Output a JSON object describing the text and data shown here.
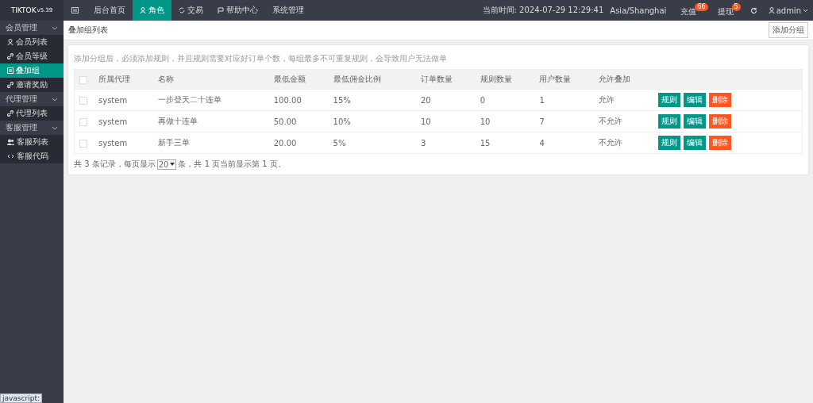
{
  "logo": {
    "name": "TIKTOK",
    "version": "v5.39"
  },
  "top_nav": [
    {
      "label": "后台首页",
      "selected": false
    },
    {
      "label": "角色",
      "selected": true
    },
    {
      "label": "交易",
      "selected": false
    },
    {
      "label": "帮助中心",
      "selected": false
    },
    {
      "label": "系统管理",
      "selected": false
    }
  ],
  "header_right": {
    "time_label": "当前时间: 2024-07-29 12:29:41",
    "timezone": "Asia/Shanghai",
    "links": [
      {
        "label": "充值",
        "badge": "66"
      },
      {
        "label": "提现",
        "badge": "5"
      }
    ],
    "user": "admin"
  },
  "sidebar": [
    {
      "label": "会员管理",
      "expanded": true,
      "children": [
        {
          "label": "会员列表",
          "selected": false
        },
        {
          "label": "会员等级",
          "selected": false
        },
        {
          "label": "叠加组",
          "selected": true
        },
        {
          "label": "邀请奖励",
          "selected": false
        }
      ]
    },
    {
      "label": "代理管理",
      "expanded": true,
      "children": [
        {
          "label": "代理列表",
          "selected": false
        }
      ]
    },
    {
      "label": "客服管理",
      "expanded": true,
      "children": [
        {
          "label": "客服列表",
          "selected": false
        },
        {
          "label": "客服代码",
          "selected": false
        }
      ]
    }
  ],
  "breadcrumb": "叠加组列表",
  "add_button": "添加分组",
  "notice": "添加分组后，必须添加规则，并且规则需要对应好订单个数，每组最多不可重复规则，会导致用户无法做单",
  "table": {
    "columns": [
      "所属代理",
      "名称",
      "最低金额",
      "最低佣金比例",
      "订单数量",
      "规则数量",
      "用户数量",
      "允许叠加"
    ],
    "header_checked": false,
    "rows": [
      {
        "checked": false,
        "cells": [
          "system",
          "一步登天二十连单",
          "100.00",
          "15%",
          "20",
          "0",
          "1",
          "允许"
        ],
        "actions": [
          "规则",
          "编辑",
          "删除"
        ]
      },
      {
        "checked": false,
        "cells": [
          "system",
          "再做十连单",
          "50.00",
          "10%",
          "10",
          "10",
          "7",
          "不允许"
        ],
        "actions": [
          "规则",
          "编辑",
          "删除"
        ]
      },
      {
        "checked": false,
        "cells": [
          "system",
          "新手三单",
          "20.00",
          "5%",
          "3",
          "15",
          "4",
          "不允许"
        ],
        "actions": [
          "规则",
          "编辑",
          "删除"
        ]
      }
    ]
  },
  "pagination": {
    "before": "共 3 条记录，每页显示",
    "page_size": "20",
    "after": "条，共 1 页当前显示第 1 页。"
  },
  "status_url": "javascript:"
}
